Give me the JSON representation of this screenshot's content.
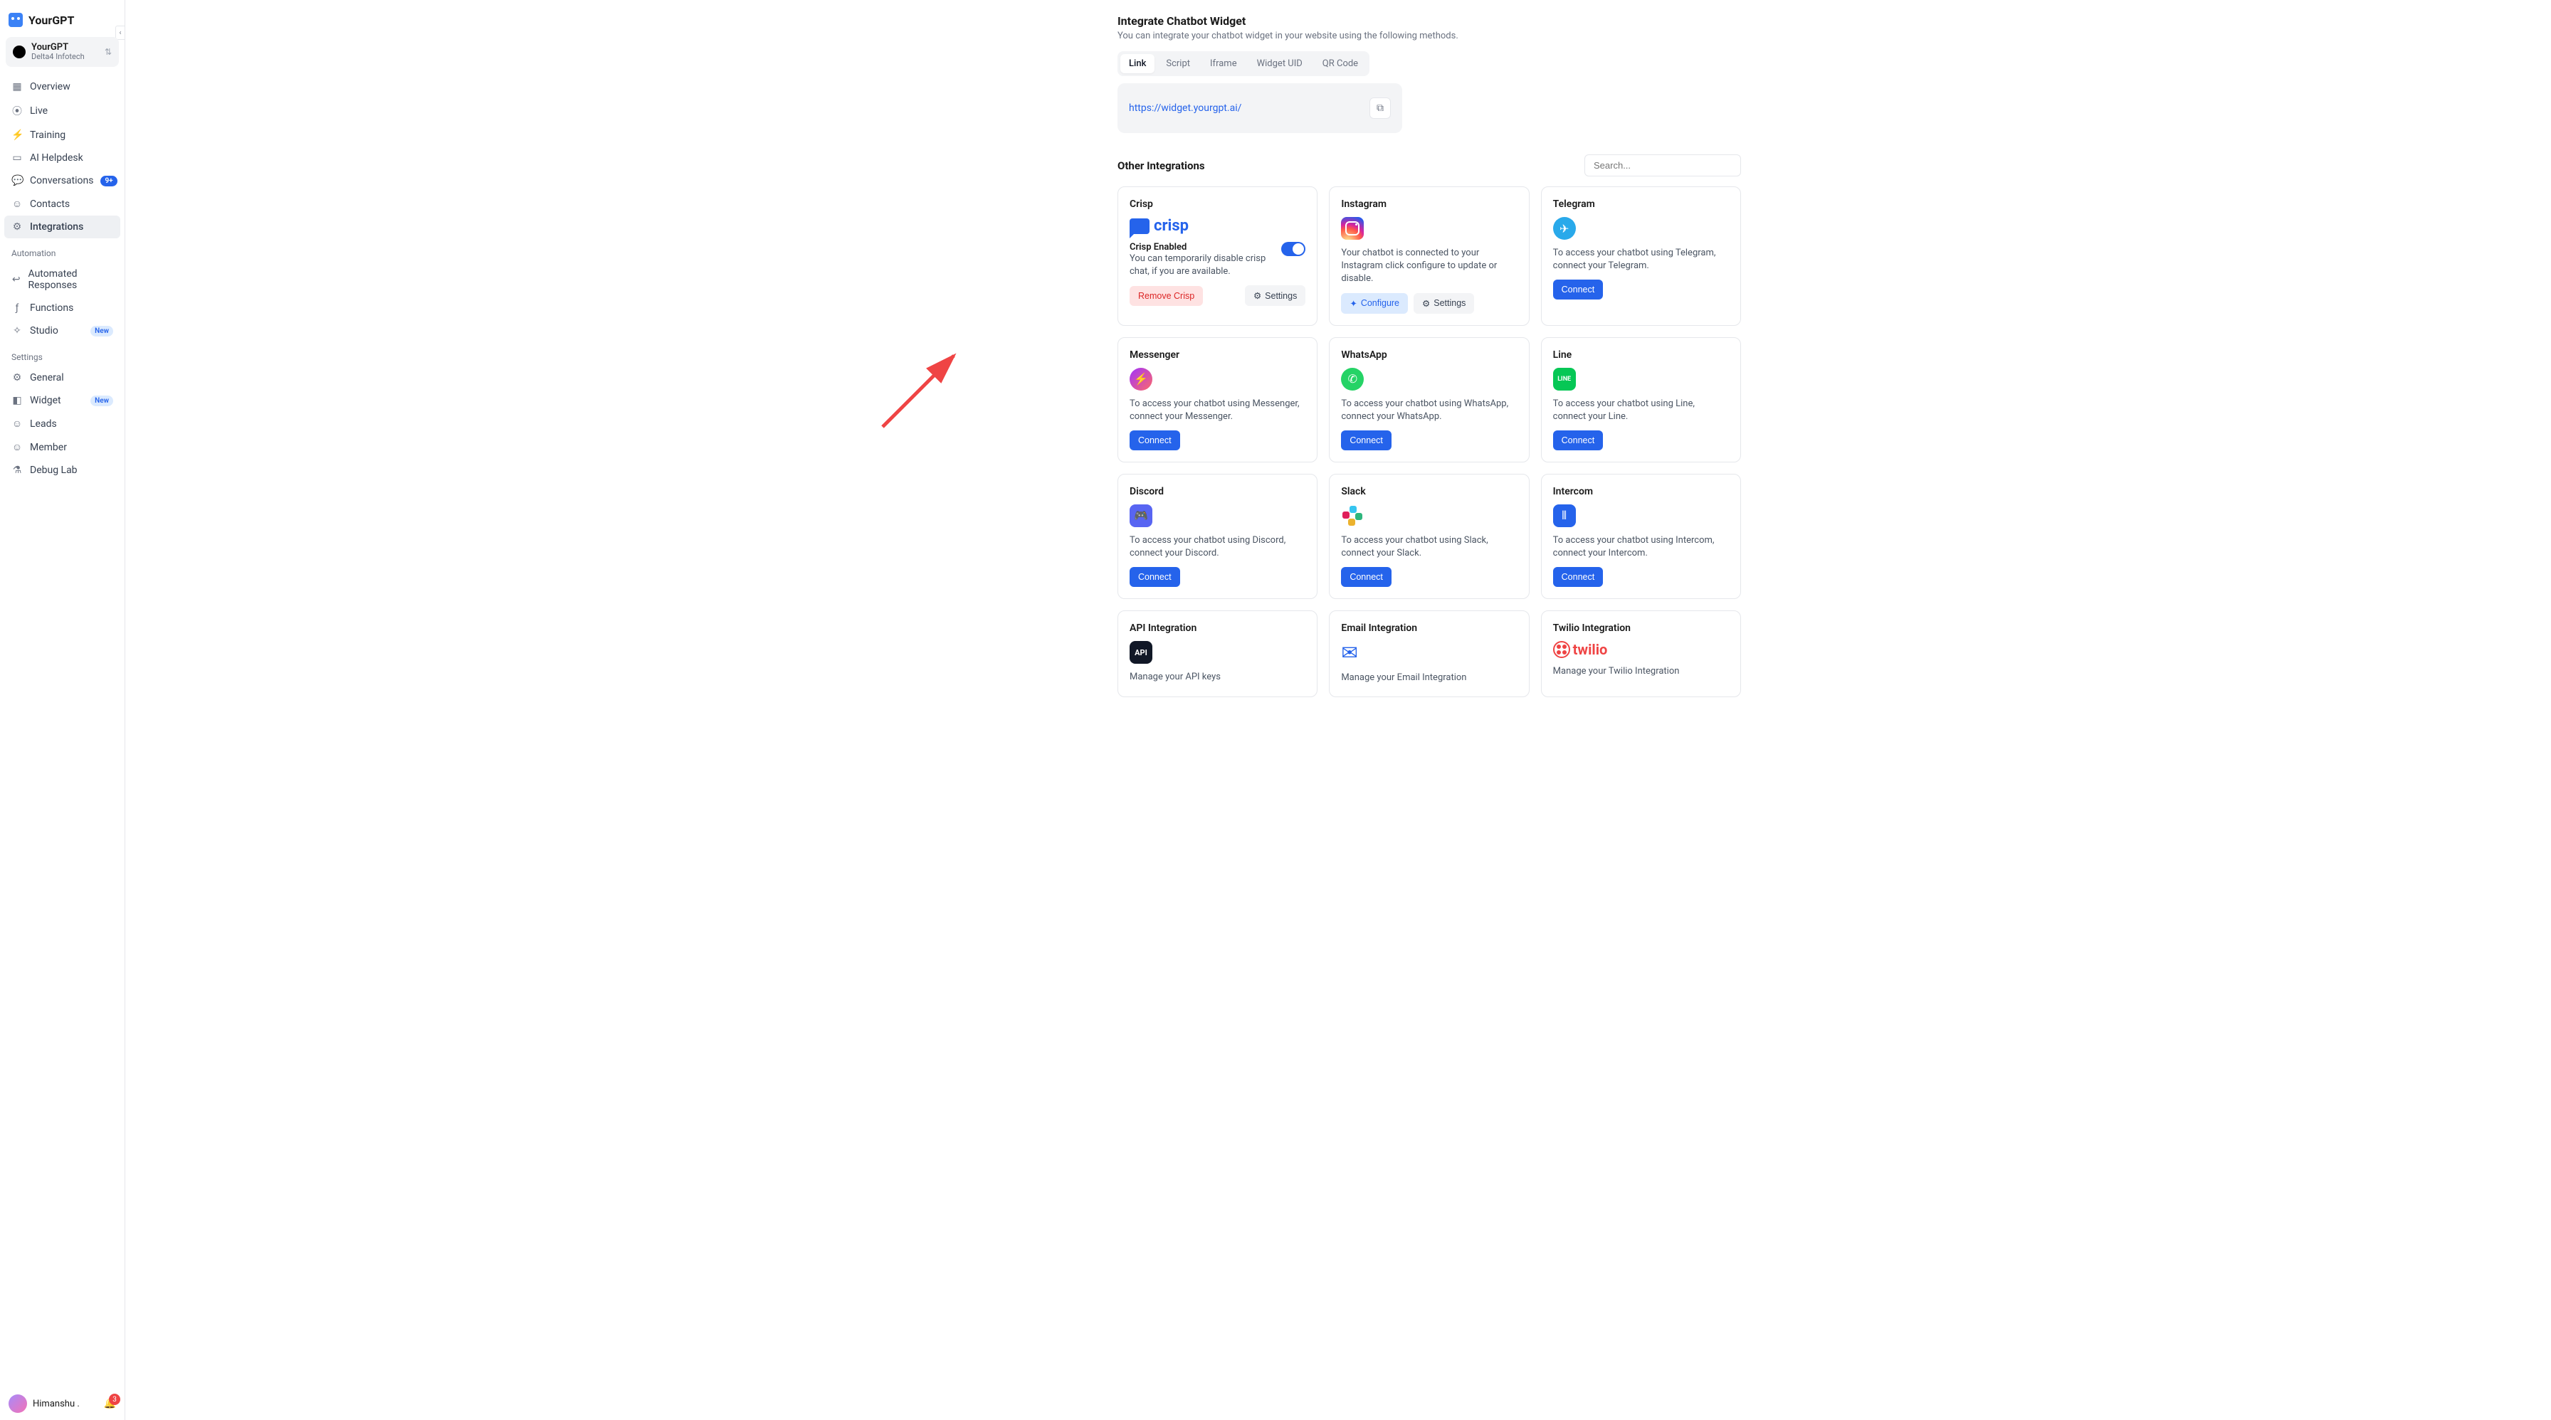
{
  "brand": "YourGPT",
  "workspace": {
    "name": "YourGPT",
    "sub": "Delta4 Infotech"
  },
  "nav": {
    "overview": "Overview",
    "live": "Live",
    "training": "Training",
    "helpdesk": "AI Helpdesk",
    "conversations": "Conversations",
    "conversations_badge": "9+",
    "contacts": "Contacts",
    "integrations": "Integrations"
  },
  "automation_label": "Automation",
  "automation": {
    "automated": "Automated Responses",
    "functions": "Functions",
    "studio": "Studio",
    "studio_badge": "New"
  },
  "settings_label": "Settings",
  "settings": {
    "general": "General",
    "widget": "Widget",
    "widget_badge": "New",
    "leads": "Leads",
    "member": "Member",
    "debug": "Debug Lab"
  },
  "user": {
    "name": "Himanshu .",
    "bell_count": "3"
  },
  "header": {
    "title": "Integrate Chatbot Widget",
    "subtitle": "You can integrate your chatbot widget in your website using the following methods."
  },
  "tabs": {
    "link": "Link",
    "script": "Script",
    "iframe": "Iframe",
    "uid": "Widget UID",
    "qr": "QR Code"
  },
  "link_url": "https://widget.yourgpt.ai/",
  "other_title": "Other Integrations",
  "search_placeholder": "Search...",
  "btn": {
    "connect": "Connect",
    "settings": "Settings",
    "configure": "Configure",
    "remove_crisp": "Remove Crisp"
  },
  "cards": {
    "crisp": {
      "title": "Crisp",
      "enabled_title": "Crisp Enabled",
      "enabled_desc": "You can temporarily disable crisp chat, if you are available."
    },
    "instagram": {
      "title": "Instagram",
      "desc": "Your chatbot is connected to your Instagram click configure to update or disable."
    },
    "telegram": {
      "title": "Telegram",
      "desc": "To access your chatbot using Telegram, connect your Telegram."
    },
    "messenger": {
      "title": "Messenger",
      "desc": "To access your chatbot using Messenger, connect your Messenger."
    },
    "whatsapp": {
      "title": "WhatsApp",
      "desc": "To access your chatbot using WhatsApp, connect your WhatsApp."
    },
    "line": {
      "title": "Line",
      "desc": "To access your chatbot using Line, connect your Line."
    },
    "discord": {
      "title": "Discord",
      "desc": "To access your chatbot using Discord, connect your Discord."
    },
    "slack": {
      "title": "Slack",
      "desc": "To access your chatbot using Slack, connect your Slack."
    },
    "intercom": {
      "title": "Intercom",
      "desc": "To access your chatbot using Intercom, connect your Intercom."
    },
    "api": {
      "title": "API Integration",
      "desc": "Manage your API keys"
    },
    "email": {
      "title": "Email Integration",
      "desc": "Manage your Email Integration"
    },
    "twilio": {
      "title": "Twilio Integration",
      "desc": "Manage your Twilio Integration"
    }
  }
}
